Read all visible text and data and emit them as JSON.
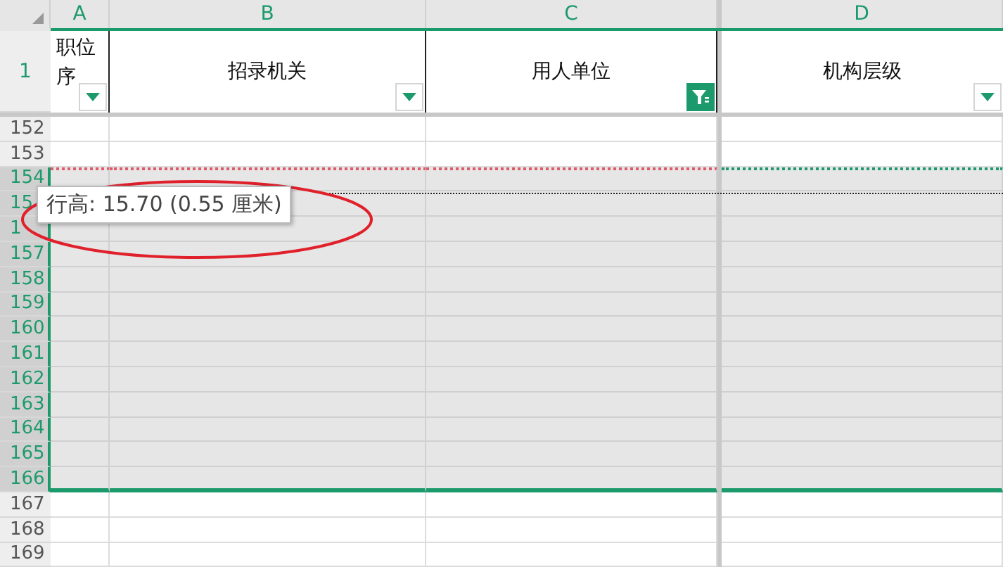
{
  "columns": [
    {
      "letter": "A"
    },
    {
      "letter": "B"
    },
    {
      "letter": "C"
    },
    {
      "letter": "D"
    }
  ],
  "header_row": {
    "number": "1",
    "cells": [
      {
        "text": "职位序",
        "filter": {
          "kind": "dropdown"
        }
      },
      {
        "text": "招录机关",
        "filter": {
          "kind": "dropdown"
        }
      },
      {
        "text": "用人单位",
        "filter": {
          "kind": "active"
        }
      },
      {
        "text": "机构层级",
        "filter": {
          "kind": "dropdown"
        }
      }
    ]
  },
  "rows": [
    {
      "number": "152",
      "selected": false
    },
    {
      "number": "153",
      "selected": false
    },
    {
      "number": "154",
      "selected": true
    },
    {
      "number": "15",
      "selected": true
    },
    {
      "number": "1",
      "selected": true
    },
    {
      "number": "157",
      "selected": true
    },
    {
      "number": "158",
      "selected": true
    },
    {
      "number": "159",
      "selected": true
    },
    {
      "number": "160",
      "selected": true
    },
    {
      "number": "161",
      "selected": true
    },
    {
      "number": "162",
      "selected": true
    },
    {
      "number": "163",
      "selected": true
    },
    {
      "number": "164",
      "selected": true
    },
    {
      "number": "165",
      "selected": true
    },
    {
      "number": "166",
      "selected": true
    },
    {
      "number": "167",
      "selected": false
    },
    {
      "number": "168",
      "selected": false
    },
    {
      "number": "169",
      "selected": false
    }
  ],
  "tooltip": {
    "text": "行高: 15.70 (0.55 厘米)"
  }
}
